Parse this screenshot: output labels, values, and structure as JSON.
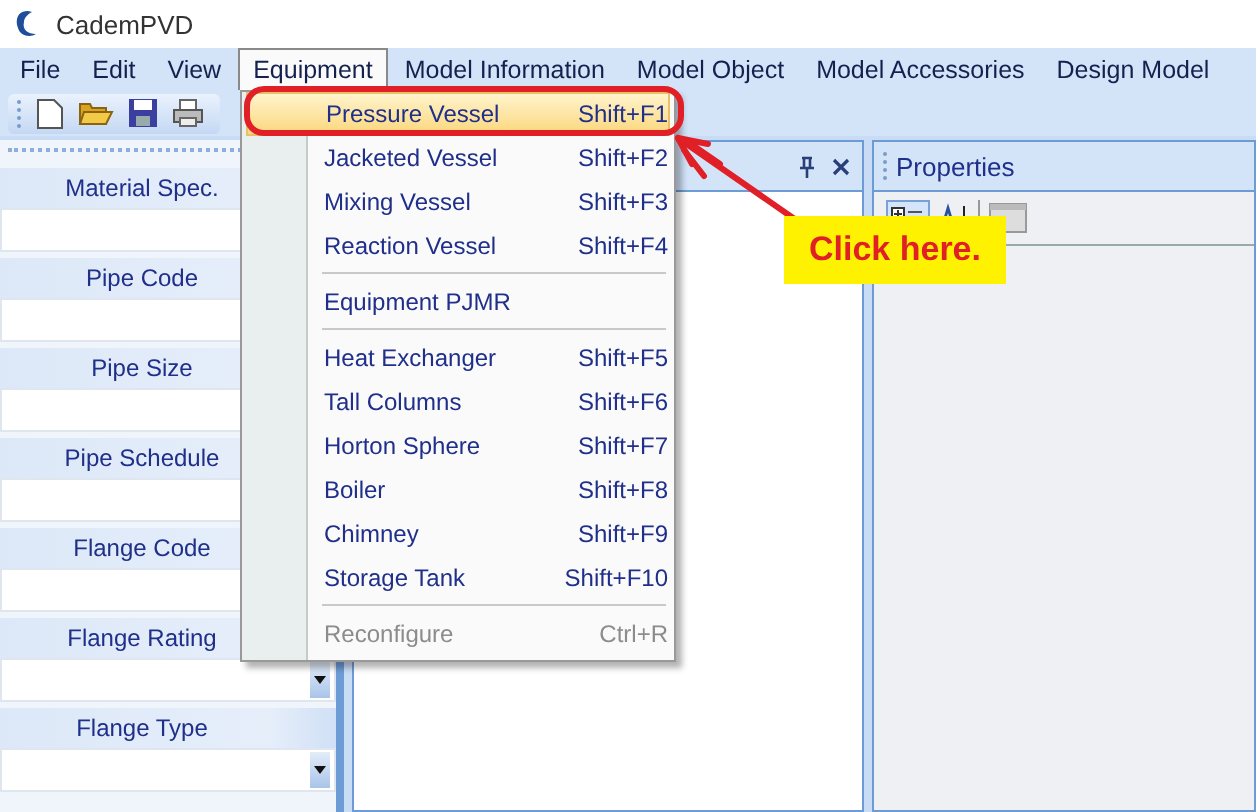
{
  "window": {
    "title": "CademPVD"
  },
  "menu_bar": [
    {
      "label": "File",
      "selected": false
    },
    {
      "label": "Edit",
      "selected": false
    },
    {
      "label": "View",
      "selected": false
    },
    {
      "label": "Equipment",
      "selected": true
    },
    {
      "label": "Model Information",
      "selected": false
    },
    {
      "label": "Model Object",
      "selected": false
    },
    {
      "label": "Model Accessories",
      "selected": false
    },
    {
      "label": "Design Model",
      "selected": false
    }
  ],
  "equipment_menu": {
    "items": [
      {
        "kind": "item",
        "label": "Pressure Vessel",
        "shortcut": "Shift+F1",
        "selected": true,
        "disabled": false
      },
      {
        "kind": "item",
        "label": "Jacketed Vessel",
        "shortcut": "Shift+F2",
        "selected": false,
        "disabled": false
      },
      {
        "kind": "item",
        "label": "Mixing Vessel",
        "shortcut": "Shift+F3",
        "selected": false,
        "disabled": false
      },
      {
        "kind": "item",
        "label": "Reaction Vessel",
        "shortcut": "Shift+F4",
        "selected": false,
        "disabled": false
      },
      {
        "kind": "separator"
      },
      {
        "kind": "item",
        "label": "Equipment PJMR",
        "selected": false,
        "disabled": false
      },
      {
        "kind": "separator"
      },
      {
        "kind": "item",
        "label": "Heat Exchanger",
        "shortcut": "Shift+F5",
        "selected": false,
        "disabled": false
      },
      {
        "kind": "item",
        "label": "Tall Columns",
        "shortcut": "Shift+F6",
        "selected": false,
        "disabled": false
      },
      {
        "kind": "item",
        "label": "Horton Sphere",
        "shortcut": "Shift+F7",
        "selected": false,
        "disabled": false
      },
      {
        "kind": "item",
        "label": "Boiler",
        "shortcut": "Shift+F8",
        "selected": false,
        "disabled": false
      },
      {
        "kind": "item",
        "label": "Chimney",
        "shortcut": "Shift+F9",
        "selected": false,
        "disabled": false
      },
      {
        "kind": "item",
        "label": "Storage Tank",
        "shortcut": "Shift+F10",
        "selected": false,
        "disabled": false
      },
      {
        "kind": "separator"
      },
      {
        "kind": "item",
        "label": "Reconfigure",
        "shortcut": "Ctrl+R",
        "selected": false,
        "disabled": true
      }
    ]
  },
  "left_panel": {
    "fields": [
      {
        "label": "Material Spec.",
        "kind": "field"
      },
      {
        "label": "Pipe Code",
        "kind": "field"
      },
      {
        "label": "Pipe Size",
        "kind": "field"
      },
      {
        "label": "Pipe Schedule",
        "kind": "field"
      },
      {
        "label": "Flange Code",
        "kind": "field"
      },
      {
        "label": "Flange Rating",
        "kind": "dropdown"
      },
      {
        "label": "Flange Type",
        "kind": "dropdown"
      }
    ]
  },
  "properties_panel": {
    "title": "Properties"
  },
  "annotation": {
    "callout": "Click here."
  }
}
